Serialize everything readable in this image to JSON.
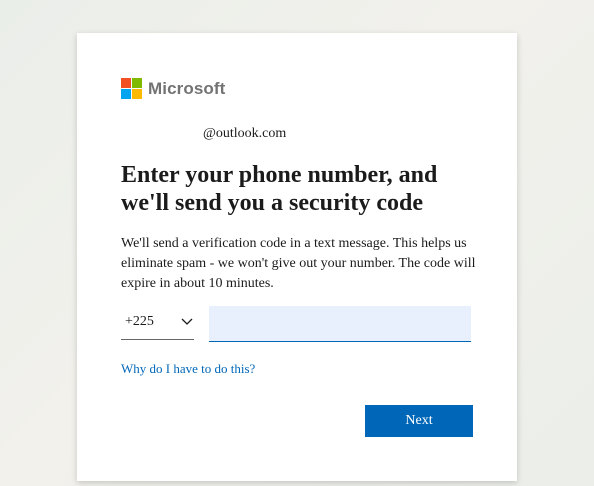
{
  "brand": {
    "name": "Microsoft",
    "colors": [
      "#f25022",
      "#7fba00",
      "#00a4ef",
      "#ffb900"
    ]
  },
  "identity": "@outlook.com",
  "title": "Enter your phone number, and we'll send you a security code",
  "description": "We'll send a verification code in a text message. This helps us eliminate spam - we won't give out your number. The code will expire in about 10 minutes.",
  "form": {
    "country_code": "+225",
    "phone_value": ""
  },
  "links": {
    "why": "Why do I have to do this?"
  },
  "buttons": {
    "next": "Next"
  },
  "colors": {
    "accent": "#0067b8",
    "input_bg": "#e8f0fe"
  }
}
